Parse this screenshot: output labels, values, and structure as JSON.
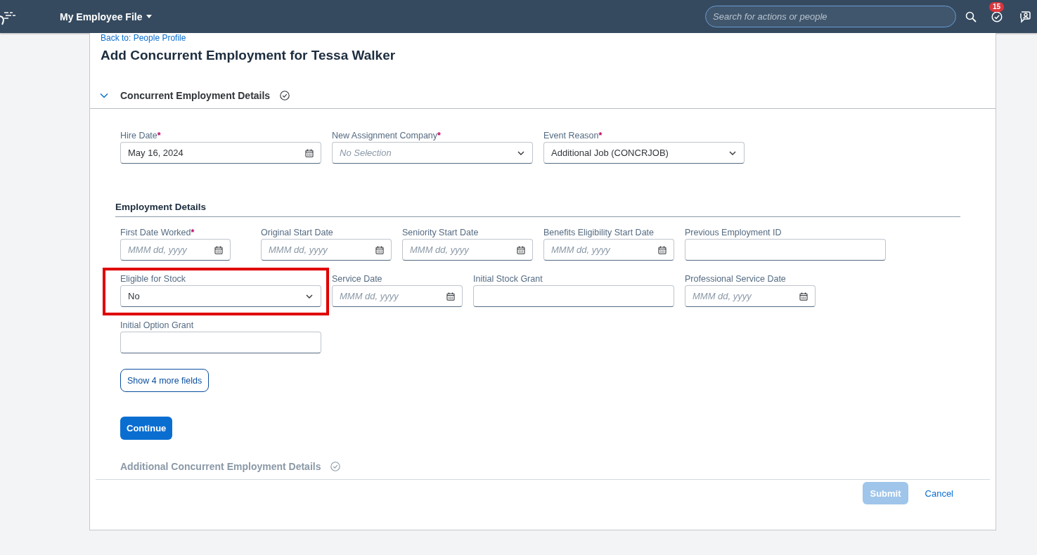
{
  "header": {
    "title": "My Employee File",
    "search": {
      "placeholder": "Search for actions or people"
    },
    "notifications_badge": "15"
  },
  "back_link": "Back to: People Profile",
  "page_title": "Add Concurrent Employment for Tessa Walker",
  "section": {
    "title": "Concurrent Employment Details",
    "expanded": true,
    "fields": [
      {
        "label": "Hire Date",
        "required_mark": "*",
        "kind": "date",
        "value": "May 16, 2024",
        "highlighted": false
      },
      {
        "label": "New Assignment Company",
        "required_mark": "*",
        "kind": "select",
        "placeholder": "No Selection",
        "highlighted": false
      },
      {
        "label": "Event Reason",
        "required_mark": "*",
        "kind": "select",
        "value": "Additional Job (CONCRJOB)",
        "highlighted": false
      }
    ]
  },
  "subsection": {
    "title": "Employment Details",
    "fields": [
      {
        "label": "First Date Worked",
        "required_mark": "*",
        "kind": "date",
        "placeholder": "MMM dd, yyyy",
        "highlighted": false
      },
      {
        "label": "Original Start Date",
        "kind": "date",
        "placeholder": "MMM dd, yyyy",
        "highlighted": false
      },
      {
        "label": "Seniority Start Date",
        "kind": "date",
        "placeholder": "MMM dd, yyyy",
        "highlighted": false
      },
      {
        "label": "Benefits Eligibility Start Date",
        "kind": "date",
        "placeholder": "MMM dd, yyyy",
        "highlighted": false
      },
      {
        "label": "Previous Employment ID",
        "kind": "text",
        "highlighted": false
      },
      {
        "label": "Eligible for Stock",
        "kind": "select",
        "value": "No",
        "highlighted": true
      },
      {
        "label": "Service Date",
        "kind": "date",
        "placeholder": "MMM dd, yyyy",
        "highlighted": false
      },
      {
        "label": "Initial Stock Grant",
        "kind": "text",
        "highlighted": false
      },
      {
        "label": "Professional Service Date",
        "kind": "date",
        "placeholder": "MMM dd, yyyy",
        "highlighted": false
      },
      {
        "label": "Initial Option Grant",
        "kind": "text",
        "highlighted": false
      }
    ]
  },
  "more_button": "Show 4 more fields",
  "continue_button": "Continue",
  "next_section": {
    "title": "Additional Concurrent Employment Details",
    "disabled": true
  },
  "footer": {
    "buttons": [
      {
        "label": "Submit",
        "kind": "primary",
        "disabled": true
      },
      {
        "label": "Cancel",
        "kind": "link",
        "disabled": false
      }
    ]
  }
}
